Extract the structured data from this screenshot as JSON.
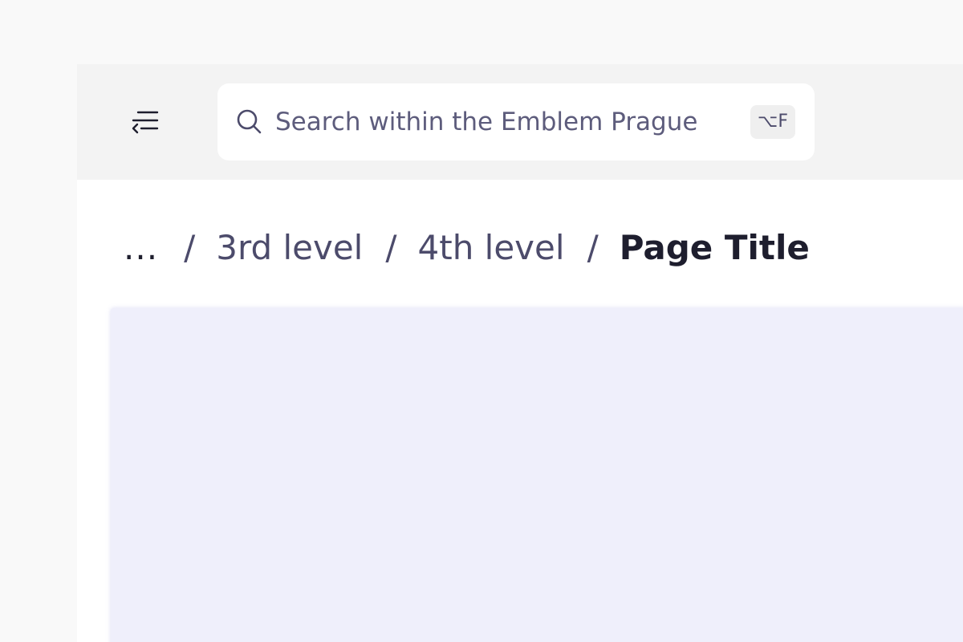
{
  "header": {
    "menu_icon": "collapse-menu-icon",
    "search": {
      "placeholder": "Search within the Emblem Prague",
      "value": "",
      "icon": "search-icon",
      "shortcut": "⌥F"
    }
  },
  "breadcrumb": {
    "ellipsis": "...",
    "separator": "/",
    "items": [
      {
        "label": "3rd level"
      },
      {
        "label": "4th level"
      }
    ],
    "current": "Page Title"
  },
  "colors": {
    "page_background": "#f9f9f9",
    "topbar_background": "#f3f3f3",
    "content_panel": "#efeffb",
    "text_primary": "#1e1e2e",
    "text_secondary": "#4c4b6b"
  }
}
